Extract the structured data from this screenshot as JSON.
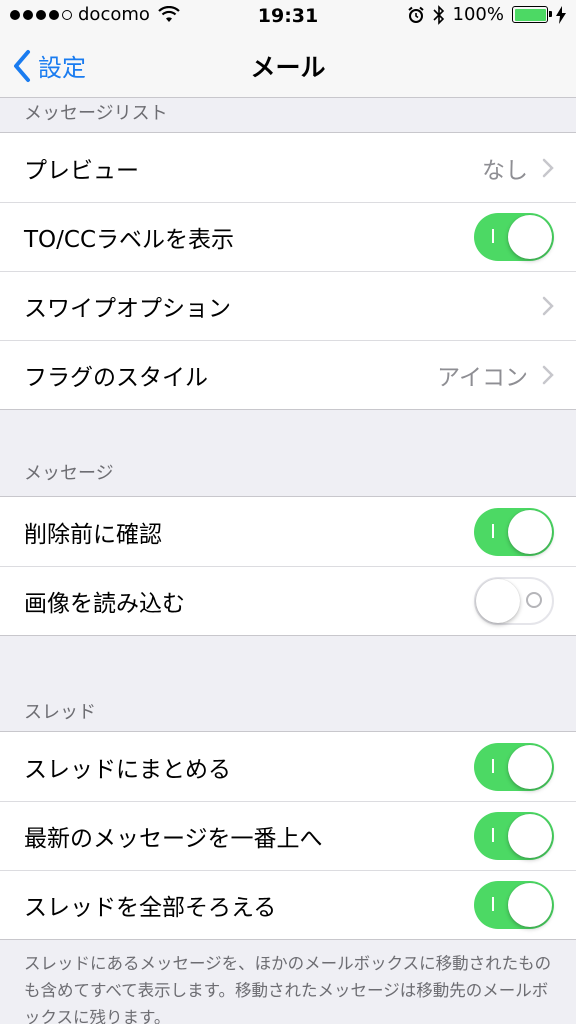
{
  "status_bar": {
    "carrier": "docomo",
    "time": "19:31",
    "battery": "100%",
    "signal_dots": 5,
    "signal_filled": 4
  },
  "nav": {
    "back_label": "設定",
    "title": "メール"
  },
  "sections": [
    {
      "header": "メッセージリスト",
      "rows": [
        {
          "label": "プレビュー",
          "value": "なし",
          "type": "disclosure"
        },
        {
          "label": "TO/CCラベルを表示",
          "type": "toggle",
          "on": true
        },
        {
          "label": "スワイプオプション",
          "value": "",
          "type": "disclosure"
        },
        {
          "label": "フラグのスタイル",
          "value": "アイコン",
          "type": "disclosure"
        }
      ]
    },
    {
      "header": "メッセージ",
      "rows": [
        {
          "label": "削除前に確認",
          "type": "toggle",
          "on": true
        },
        {
          "label": "画像を読み込む",
          "type": "toggle",
          "on": false
        }
      ]
    },
    {
      "header": "スレッド",
      "rows": [
        {
          "label": "スレッドにまとめる",
          "type": "toggle",
          "on": true
        },
        {
          "label": "最新のメッセージを一番上へ",
          "type": "toggle",
          "on": true
        },
        {
          "label": "スレッドを全部そろえる",
          "type": "toggle",
          "on": true
        }
      ]
    }
  ],
  "footer": "スレッドにあるメッセージを、ほかのメールボックスに移動されたものも含めてすべて表示します。移動されたメッセージは移動先のメールボックスに残ります。",
  "colors": {
    "accent": "#1a7cf0",
    "toggle_on": "#4cd964",
    "background": "#efeff4"
  }
}
